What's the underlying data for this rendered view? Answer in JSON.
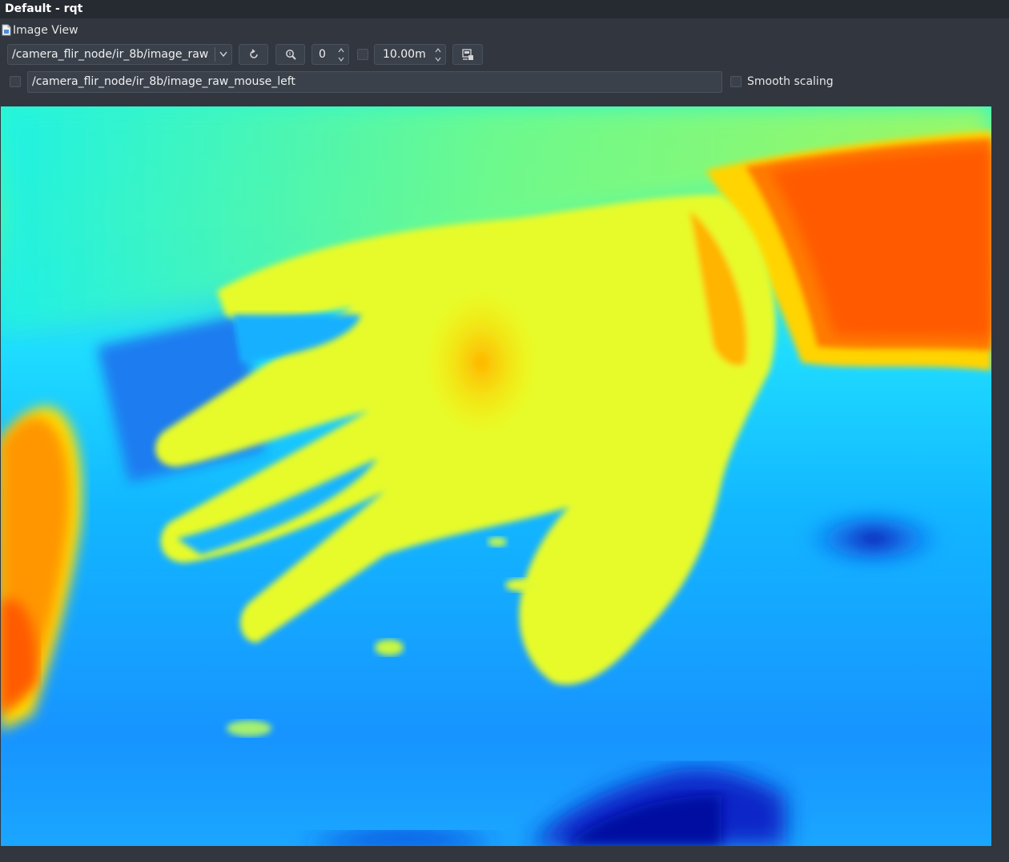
{
  "window": {
    "title": "Default - rqt"
  },
  "plugin": {
    "title": "Image View",
    "icon": "document-icon"
  },
  "toolbar": {
    "topic": "/camera_flir_node/ir_8b/image_raw",
    "refresh_icon": "refresh-icon",
    "zoom_icon": "zoom-icon",
    "rotation_value": "0",
    "max_range_value": "10.00m",
    "save_icon": "save-image-icon",
    "mouse_topic": "/camera_flir_node/ir_8b/image_raw_mouse_left",
    "smooth_scaling_label": "Smooth scaling",
    "smooth_scaling_checked": false,
    "publish_mouse_checked": false,
    "dynamic_range_checked": false
  },
  "colors": {
    "background": "#31363f",
    "titlebar": "#262a31",
    "widget": "#3b414b"
  }
}
